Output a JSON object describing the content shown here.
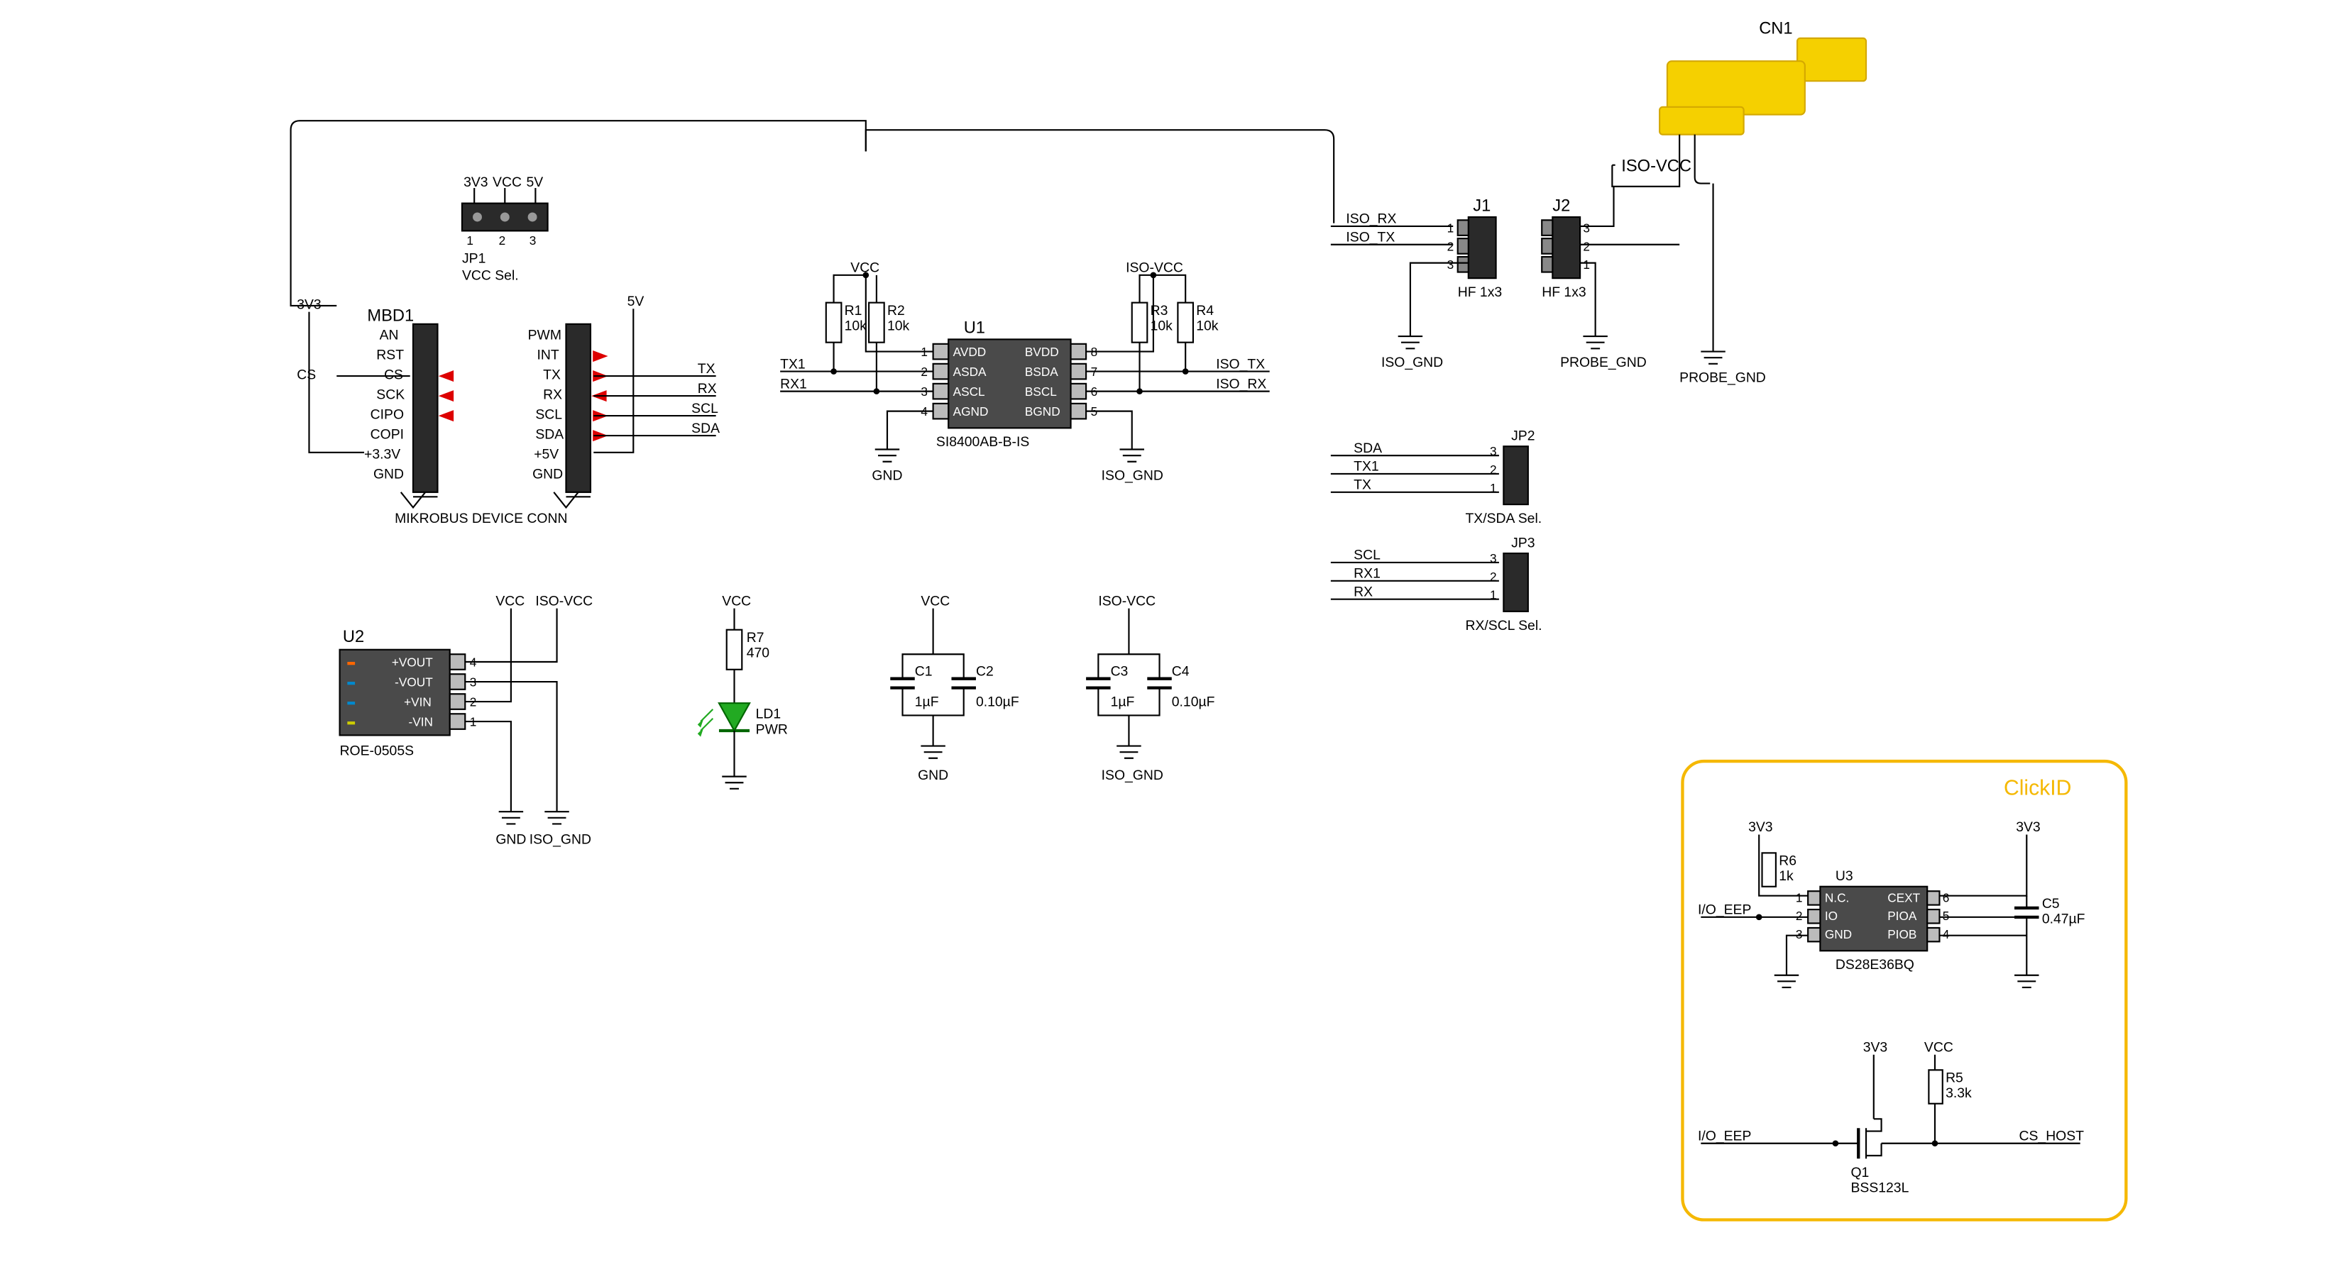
{
  "components": {
    "CN1": {
      "ref": "CN1",
      "type": "BNC/connector"
    },
    "JP1": {
      "ref": "JP1",
      "label": "VCC Sel.",
      "nets": [
        "3V3",
        "VCC",
        "5V"
      ]
    },
    "JP2": {
      "ref": "JP2",
      "label": "TX/SDA Sel.",
      "pins": {
        "3": "SDA",
        "2": "TX1",
        "1": "TX"
      }
    },
    "JP3": {
      "ref": "JP3",
      "label": "RX/SCL Sel.",
      "pins": {
        "3": "SCL",
        "2": "RX1",
        "1": "RX"
      }
    },
    "J1": {
      "ref": "J1",
      "label": "HF 1x3",
      "pins": {
        "1": "ISO_RX",
        "2": "ISO_TX",
        "3": "ISO_GND"
      }
    },
    "J2": {
      "ref": "J2",
      "label": "HF 1x3",
      "pins": {
        "3": "",
        "2": "",
        "1": ""
      }
    },
    "MBD1": {
      "ref": "MBD1",
      "label": "MIKROBUS DEVICE CONN",
      "left": [
        "AN",
        "RST",
        "CS",
        "SCK",
        "CIPO",
        "COPI",
        "+3.3V",
        "GND"
      ],
      "right": [
        "PWM",
        "INT",
        "TX",
        "RX",
        "SCL",
        "SDA",
        "+5V",
        "GND"
      ],
      "nets_left": {
        "CS": "CS",
        "+3.3V": "3V3"
      },
      "nets_right": {
        "TX": "TX",
        "RX": "RX",
        "SCL": "SCL",
        "SDA": "SDA",
        "+5V": "5V"
      }
    },
    "U1": {
      "ref": "U1",
      "part": "SI8400AB-B-IS",
      "pins_left": {
        "1": "AVDD",
        "2": "ASDA",
        "3": "ASCL",
        "4": "AGND"
      },
      "pins_right": {
        "8": "BVDD",
        "7": "BSDA",
        "6": "BSCL",
        "5": "BGND"
      },
      "nets": {
        "ASDA": "TX1",
        "ASCL": "RX1",
        "BSDA": "ISO_TX",
        "BSCL": "ISO_RX",
        "AVDD": "VCC",
        "BVDD": "ISO-VCC",
        "AGND": "GND",
        "BGND": "ISO_GND"
      }
    },
    "U2": {
      "ref": "U2",
      "part": "ROE-0505S",
      "pins": {
        "4": "+VOUT",
        "3": "-VOUT",
        "2": "+VIN",
        "1": "-VIN"
      },
      "nets": {
        "+VOUT": "ISO-VCC",
        "-VOUT": "ISO_GND",
        "+VIN": "VCC",
        "-VIN": "GND"
      }
    },
    "U3": {
      "ref": "U3",
      "part": "DS28E36BQ",
      "pins_left": {
        "1": "N.C.",
        "2": "IO",
        "3": "GND"
      },
      "pins_right": {
        "6": "CEXT",
        "5": "PIOA",
        "4": "PIOB"
      }
    },
    "R1": {
      "ref": "R1",
      "value": "10k"
    },
    "R2": {
      "ref": "R2",
      "value": "10k"
    },
    "R3": {
      "ref": "R3",
      "value": "10k"
    },
    "R4": {
      "ref": "R4",
      "value": "10k"
    },
    "R5": {
      "ref": "R5",
      "value": "3.3k"
    },
    "R6": {
      "ref": "R6",
      "value": "1k"
    },
    "R7": {
      "ref": "R7",
      "value": "470"
    },
    "C1": {
      "ref": "C1",
      "value": "1µF"
    },
    "C2": {
      "ref": "C2",
      "value": "0.10µF"
    },
    "C3": {
      "ref": "C3",
      "value": "1µF"
    },
    "C4": {
      "ref": "C4",
      "value": "0.10µF"
    },
    "C5": {
      "ref": "C5",
      "value": "0.47µF"
    },
    "LD1": {
      "ref": "LD1",
      "label": "PWR"
    },
    "Q1": {
      "ref": "Q1",
      "part": "BSS123L"
    }
  },
  "nets": {
    "power": [
      "3V3",
      "5V",
      "VCC",
      "ISO-VCC"
    ],
    "ground": [
      "GND",
      "ISO_GND",
      "PROBE_GND"
    ],
    "signal": [
      "CS",
      "TX",
      "RX",
      "SCL",
      "SDA",
      "TX1",
      "RX1",
      "ISO_TX",
      "ISO_RX",
      "I/O_EEP",
      "CS_HOST"
    ]
  },
  "labels": {
    "clickid": "ClickID",
    "vcc_sel": "VCC Sel.",
    "tx_sda_sel": "TX/SDA Sel.",
    "rx_scl_sel": "RX/SCL Sel.",
    "mikrobus": "MIKROBUS DEVICE CONN",
    "hf1x3": "HF 1x3"
  }
}
